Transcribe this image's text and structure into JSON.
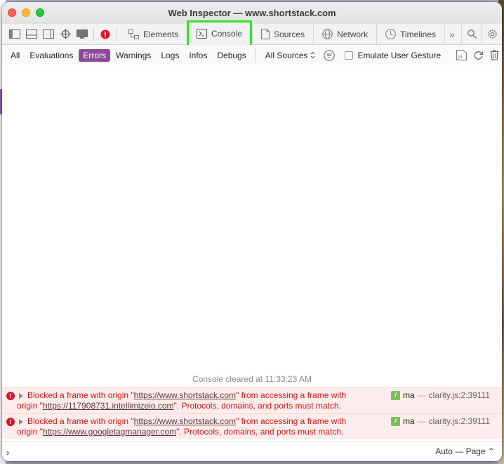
{
  "window": {
    "title": "Web Inspector — www.shortstack.com"
  },
  "tabs": [
    {
      "label": "Elements"
    },
    {
      "label": "Console"
    },
    {
      "label": "Sources"
    },
    {
      "label": "Network"
    },
    {
      "label": "Timelines"
    }
  ],
  "filters": {
    "levels": [
      "All",
      "Evaluations",
      "Errors",
      "Warnings",
      "Logs",
      "Infos",
      "Debugs"
    ],
    "active": "Errors",
    "sources_label": "All Sources",
    "emulate_label": "Emulate User Gesture"
  },
  "console": {
    "cleared_text": "Console cleared at 11:33:23 AM",
    "messages": [
      {
        "line1_pre": "Blocked a frame with origin \"",
        "line1_url": "https://www.shortstack.com",
        "line1_post": "\" from accessing a frame with",
        "line2_pre": "origin \"",
        "line2_url": "https://117908731.intellimizeio.com",
        "line2_post": "\". Protocols, domains, and ports must match.",
        "func_badge": "f",
        "func_name": "ma",
        "dash": "—",
        "location": "clarity.js:2:39111"
      },
      {
        "line1_pre": "Blocked a frame with origin \"",
        "line1_url": "https://www.shortstack.com",
        "line1_post": "\" from accessing a frame with",
        "line2_pre": "origin \"",
        "line2_url": "https://www.googletagmanager.com",
        "line2_post": "\". Protocols, domains, and ports must match.",
        "func_badge": "f",
        "func_name": "ma",
        "dash": "—",
        "location": "clarity.js:2:39111"
      }
    ]
  },
  "prompt": {
    "symbol": "›",
    "context": "Auto — Page ⌃"
  },
  "colors": {
    "active_filter": "#8e4a9a",
    "highlight": "#2ee61d",
    "error": "#c41a16"
  }
}
